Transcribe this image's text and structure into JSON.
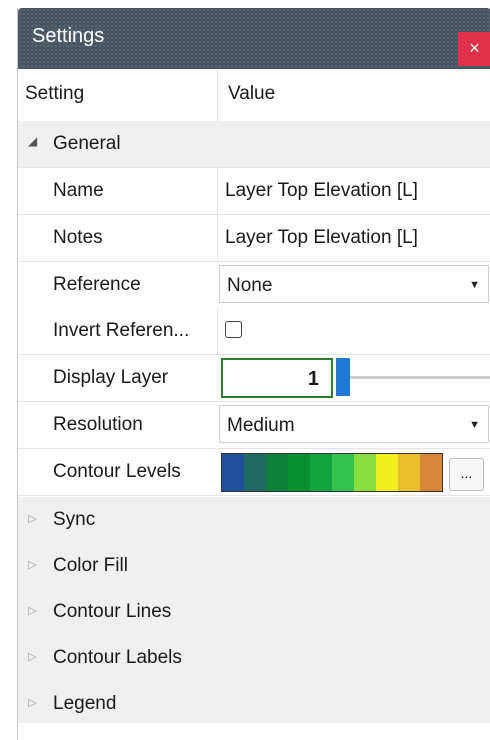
{
  "window": {
    "title": "Settings",
    "close_label": "×"
  },
  "header": {
    "col1": "Setting",
    "col2": "Value"
  },
  "general": {
    "label": "General",
    "name": {
      "label": "Name",
      "value": "Layer Top Elevation [L]"
    },
    "notes": {
      "label": "Notes",
      "value": "Layer Top Elevation [L]"
    },
    "reference": {
      "label": "Reference",
      "value": "None"
    },
    "invert": {
      "label": "Invert Referen...",
      "checked": false
    },
    "display_layer": {
      "label": "Display Layer",
      "value": "1"
    },
    "resolution": {
      "label": "Resolution",
      "value": "Medium"
    },
    "contour_levels": {
      "label": "Contour Levels",
      "button_label": "...",
      "colors": [
        "#1f4e9c",
        "#1e6b63",
        "#0c7f39",
        "#0a8f34",
        "#13a33f",
        "#36c24e",
        "#88dd3c",
        "#f1ef1d",
        "#e7be2c",
        "#d9853a"
      ]
    }
  },
  "categories": [
    {
      "label": "Sync"
    },
    {
      "label": "Color Fill"
    },
    {
      "label": "Contour Lines"
    },
    {
      "label": "Contour Labels"
    },
    {
      "label": "Legend"
    }
  ],
  "icons": {
    "expanded": "◢",
    "collapsed": "▷",
    "dropdown": "▼"
  }
}
